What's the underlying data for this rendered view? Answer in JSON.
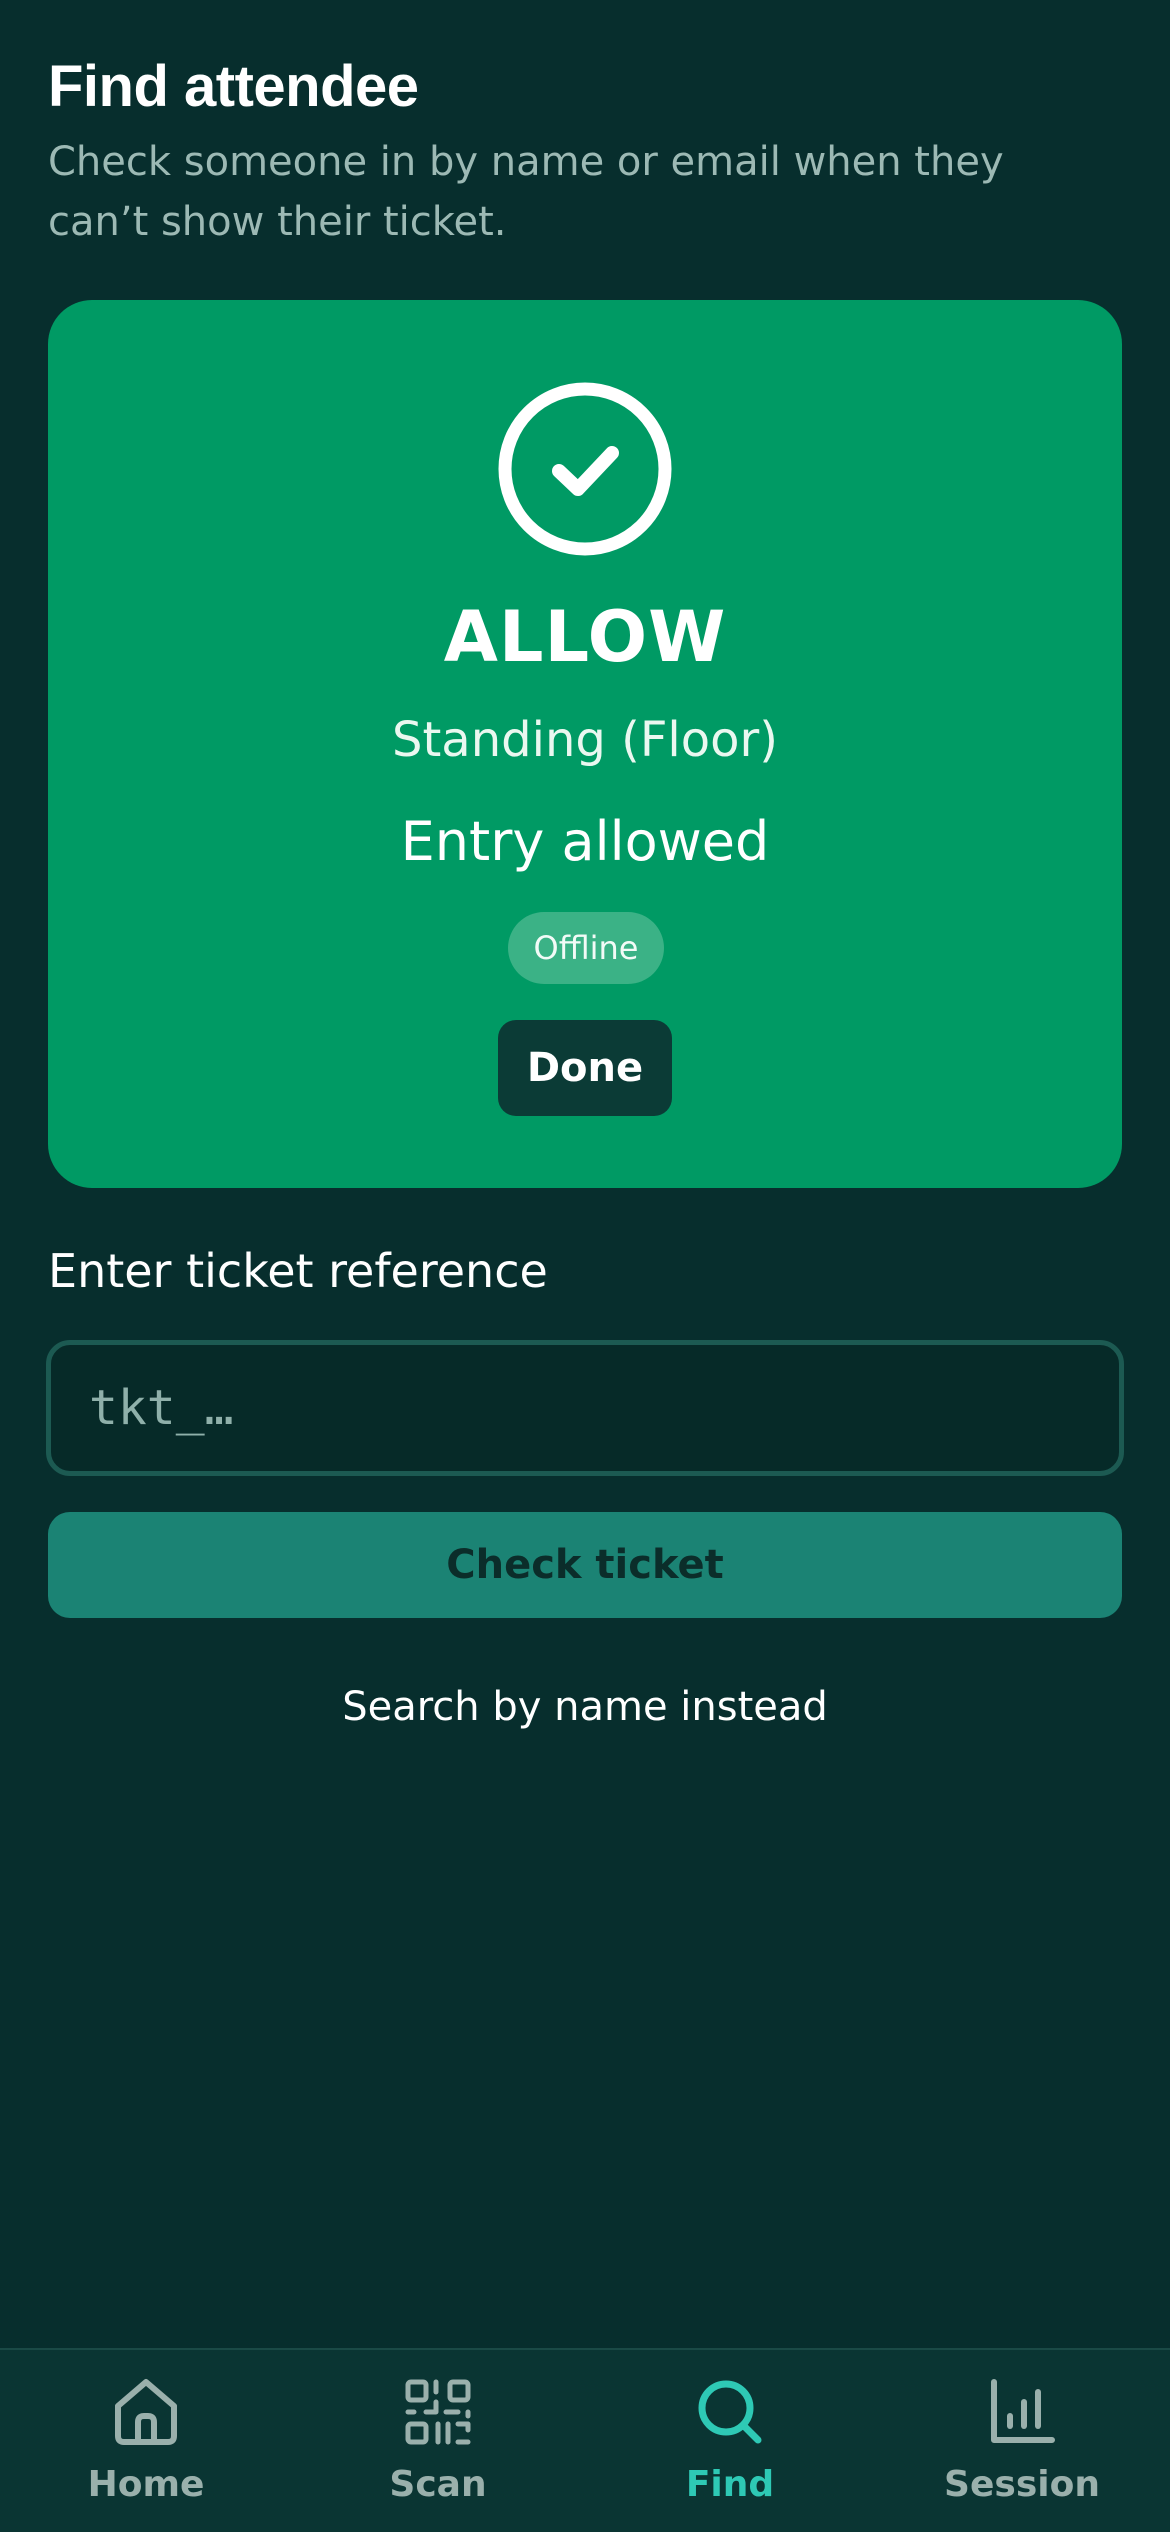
{
  "header": {
    "title": "Find attendee",
    "subtitle": "Check someone in by name or email when they can’t show their ticket."
  },
  "result": {
    "status": "ALLOW",
    "ticket_type": "Standing (Floor)",
    "message": "Entry allowed",
    "badge": "Offline",
    "done_label": "Done",
    "icon": "check-circle-icon",
    "color": "#009a64"
  },
  "lookup": {
    "label": "Enter ticket reference",
    "value": "",
    "placeholder": "tkt_…",
    "check_label": "Check ticket",
    "alt_link": "Search by name instead"
  },
  "tabs": [
    {
      "label": "Home",
      "icon": "home-icon",
      "active": false
    },
    {
      "label": "Scan",
      "icon": "qr-code-icon",
      "active": false
    },
    {
      "label": "Find",
      "icon": "search-icon",
      "active": true
    },
    {
      "label": "Session",
      "icon": "bar-chart-icon",
      "active": false
    }
  ],
  "colors": {
    "background": "#072e2d",
    "accent": "#2ec9b5",
    "allow": "#009a64",
    "button": "#1b8374"
  }
}
